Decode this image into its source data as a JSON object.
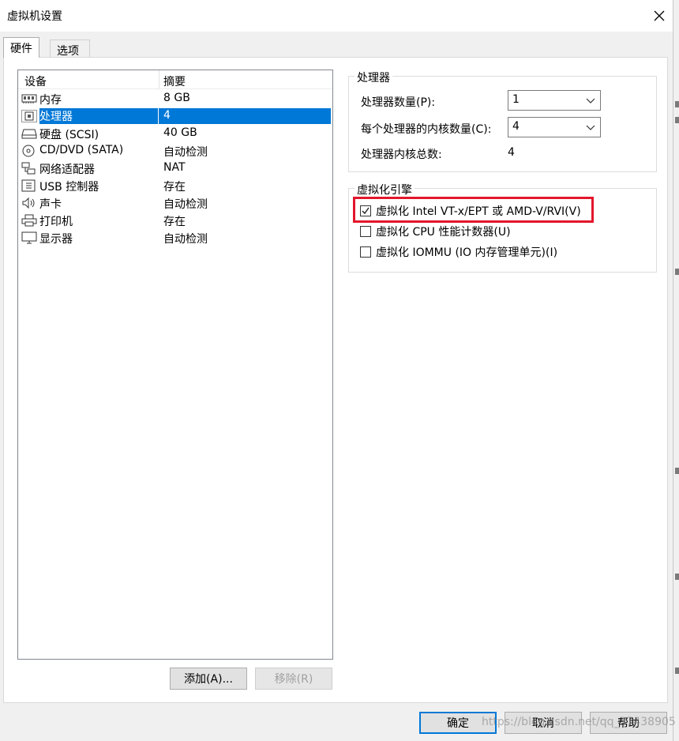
{
  "window": {
    "title": "虚拟机设置"
  },
  "tabs": [
    {
      "label": "硬件",
      "active": true
    },
    {
      "label": "选项",
      "active": false
    }
  ],
  "device_list": {
    "columns": [
      "设备",
      "摘要"
    ],
    "rows": [
      {
        "icon": "memory-icon",
        "device": "内存",
        "summary": "8 GB"
      },
      {
        "icon": "cpu-icon",
        "device": "处理器",
        "summary": "4",
        "selected": true
      },
      {
        "icon": "hard-disk-icon",
        "device": "硬盘 (SCSI)",
        "summary": "40 GB"
      },
      {
        "icon": "cd-dvd-icon",
        "device": "CD/DVD (SATA)",
        "summary": "自动检测"
      },
      {
        "icon": "network-icon",
        "device": "网络适配器",
        "summary": "NAT"
      },
      {
        "icon": "usb-icon",
        "device": "USB 控制器",
        "summary": "存在"
      },
      {
        "icon": "speaker-icon",
        "device": "声卡",
        "summary": "自动检测"
      },
      {
        "icon": "printer-icon",
        "device": "打印机",
        "summary": "存在"
      },
      {
        "icon": "monitor-icon",
        "device": "显示器",
        "summary": "自动检测"
      }
    ]
  },
  "list_buttons": {
    "add": "添加(A)...",
    "remove": "移除(R)"
  },
  "processor_group": {
    "title": "处理器",
    "processors_label": "处理器数量(P):",
    "processors_value": "1",
    "cores_label": "每个处理器的内核数量(C):",
    "cores_value": "4",
    "total_label": "处理器内核总数:",
    "total_value": "4"
  },
  "virtualization_group": {
    "title": "虚拟化引擎",
    "options": [
      {
        "label": "虚拟化 Intel VT-x/EPT 或 AMD-V/RVI(V)",
        "checked": true
      },
      {
        "label": "虚拟化 CPU 性能计数器(U)",
        "checked": false
      },
      {
        "label": "虚拟化 IOMMU (IO 内存管理单元)(I)",
        "checked": false
      }
    ]
  },
  "footer_buttons": {
    "ok": "确定",
    "cancel": "取消",
    "help": "帮助"
  },
  "watermark": "https://blog.csdn.net/qq_37438905",
  "colors": {
    "selection": "#0078d7",
    "highlight": "#e3162b"
  }
}
